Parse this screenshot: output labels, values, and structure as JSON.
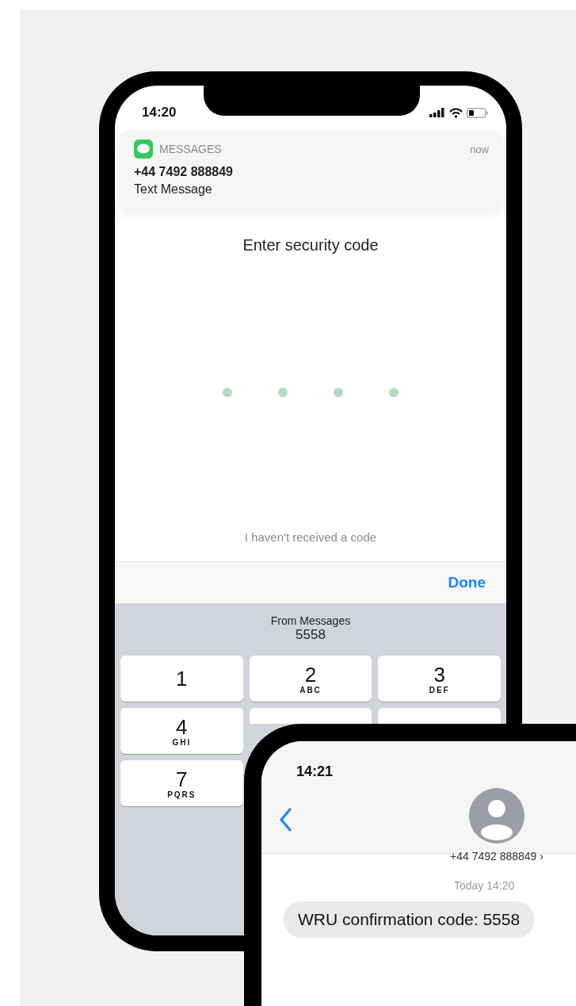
{
  "code_phone": {
    "status_bar": {
      "time": "14:20"
    },
    "notification": {
      "app": "MESSAGES",
      "time": "now",
      "sender": "+44 7492 888849",
      "body": "Text Message"
    },
    "prompt": "Enter security code",
    "resend_link": "I haven't received a code",
    "toolbar": {
      "done": "Done"
    },
    "suggestion": {
      "source": "From Messages",
      "code": "5558"
    },
    "keys": [
      {
        "kind": "key",
        "digit": "1"
      },
      {
        "kind": "key",
        "digit": "2",
        "letters": "ABC"
      },
      {
        "kind": "key",
        "digit": "3",
        "letters": "DEF"
      },
      {
        "kind": "key",
        "digit": "4",
        "letters": "GHI"
      },
      {
        "kind": "hidden"
      },
      {
        "kind": "hidden"
      },
      {
        "kind": "key",
        "digit": "7",
        "letters": "PQRS"
      }
    ]
  },
  "messages_phone": {
    "status_bar": {
      "time": "14:21"
    },
    "contact": "+44 7492 888849 ›",
    "timestamp": "Today 14:20",
    "message": "WRU confirmation code: 5558"
  }
}
